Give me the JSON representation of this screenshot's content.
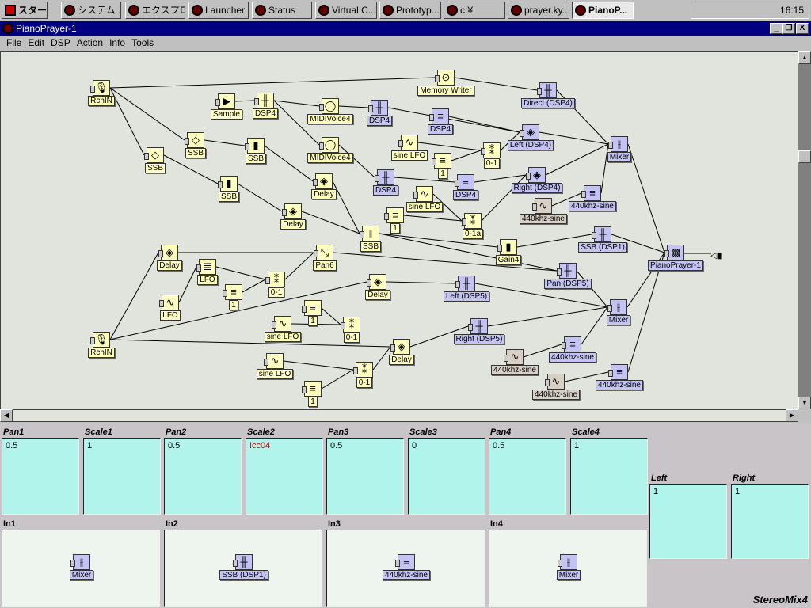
{
  "taskbar": {
    "start": "スタート",
    "buttons": [
      "システム ...",
      "エクスプロ...",
      "Launcher",
      "Status",
      "Virtual C...",
      "Prototyp...",
      "c:¥",
      "prayer.ky...",
      "PianoP..."
    ],
    "clock": "16:15"
  },
  "window": {
    "title": "PianoPrayer-1",
    "controls": [
      "_",
      "❐",
      "X"
    ]
  },
  "menu": [
    "File",
    "Edit",
    "DSP",
    "Action",
    "Info",
    "Tools"
  ],
  "graph": {
    "nodes": [
      {
        "label": "RchIN",
        "kind": "y",
        "icon": "mic-icon",
        "glyph": "🎙"
      },
      {
        "label": "Sample",
        "kind": "y",
        "icon": "sample-icon",
        "glyph": "▶"
      },
      {
        "label": "DSP4",
        "kind": "y",
        "icon": "dsp-icon",
        "glyph": "╫"
      },
      {
        "label": "MIDIVoice4",
        "kind": "y",
        "icon": "midi-icon",
        "glyph": "◯"
      },
      {
        "label": "MIDIVoice4",
        "kind": "y",
        "icon": "midi-icon",
        "glyph": "◯"
      },
      {
        "label": "SSB",
        "kind": "y",
        "icon": "ssb-ring-icon",
        "glyph": "◇"
      },
      {
        "label": "SSB",
        "kind": "y",
        "icon": "ssb-ring-icon",
        "glyph": "◇"
      },
      {
        "label": "SSB",
        "kind": "y",
        "icon": "fader-icon",
        "glyph": "▮"
      },
      {
        "label": "SSB",
        "kind": "y",
        "icon": "fader-icon",
        "glyph": "▮"
      },
      {
        "label": "Delay",
        "kind": "y",
        "icon": "delay-icon",
        "glyph": "◈"
      },
      {
        "label": "Delay",
        "kind": "y",
        "icon": "delay-icon",
        "glyph": "◈"
      },
      {
        "label": "SSB",
        "kind": "y",
        "icon": "mixer-icon",
        "glyph": "⫲"
      },
      {
        "label": "sine LFO",
        "kind": "y",
        "icon": "sine-icon",
        "glyph": "∿"
      },
      {
        "label": "1",
        "kind": "y",
        "icon": "constant-icon",
        "glyph": "≡"
      },
      {
        "label": "0-1",
        "kind": "y",
        "icon": "range-icon",
        "glyph": "⁑"
      },
      {
        "label": "sine LFO",
        "kind": "y",
        "icon": "sine-icon",
        "glyph": "∿"
      },
      {
        "label": "1",
        "kind": "y",
        "icon": "constant-icon",
        "glyph": "≡"
      },
      {
        "label": "0-1a",
        "kind": "y",
        "icon": "range-icon",
        "glyph": "⁑"
      },
      {
        "label": "Gain4",
        "kind": "y",
        "icon": "fader-icon",
        "glyph": "▮"
      },
      {
        "label": "Memory Writer",
        "kind": "y",
        "icon": "memory-icon",
        "glyph": "⊙"
      },
      {
        "label": "Delay",
        "kind": "y",
        "icon": "delay-icon",
        "glyph": "◈"
      },
      {
        "label": "LFO",
        "kind": "y",
        "icon": "lfo-icon",
        "glyph": "≣"
      },
      {
        "label": "LFO",
        "kind": "y",
        "icon": "sine-icon",
        "glyph": "∿"
      },
      {
        "label": "1",
        "kind": "y",
        "icon": "constant-icon",
        "glyph": "≡"
      },
      {
        "label": "0-1",
        "kind": "y",
        "icon": "range-icon",
        "glyph": "⁑"
      },
      {
        "label": "Pan6",
        "kind": "y",
        "icon": "pan-icon",
        "glyph": "⤡"
      },
      {
        "label": "Delay",
        "kind": "y",
        "icon": "delay-icon",
        "glyph": "◈"
      },
      {
        "label": "1",
        "kind": "y",
        "icon": "constant-icon",
        "glyph": "≡"
      },
      {
        "label": "sine LFO",
        "kind": "y",
        "icon": "sine-icon",
        "glyph": "∿"
      },
      {
        "label": "0-1",
        "kind": "y",
        "icon": "range-icon",
        "glyph": "⁑"
      },
      {
        "label": "RchIN",
        "kind": "y",
        "icon": "mic-icon",
        "glyph": "🎙"
      },
      {
        "label": "Delay",
        "kind": "y",
        "icon": "delay-icon",
        "glyph": "◈"
      },
      {
        "label": "sine LFO",
        "kind": "y",
        "icon": "sine-icon",
        "glyph": "∿"
      },
      {
        "label": "0-1",
        "kind": "y",
        "icon": "range-icon",
        "glyph": "⁑"
      },
      {
        "label": "1",
        "kind": "y",
        "icon": "constant-icon",
        "glyph": "≡"
      },
      {
        "label": "Direct (DSP4)",
        "kind": "b",
        "icon": "dsp-icon",
        "glyph": "╫"
      },
      {
        "label": "DSP4",
        "kind": "b",
        "icon": "dsp-icon",
        "glyph": "╫"
      },
      {
        "label": "DSP4",
        "kind": "b",
        "icon": "constant-icon",
        "glyph": "≡"
      },
      {
        "label": "Left (DSP4)",
        "kind": "b",
        "icon": "delay-icon",
        "glyph": "◈"
      },
      {
        "label": "Mixer",
        "kind": "b",
        "icon": "mixer-icon",
        "glyph": "⫲"
      },
      {
        "label": "DSP4",
        "kind": "b",
        "icon": "dsp-icon",
        "glyph": "╫"
      },
      {
        "label": "DSP4",
        "kind": "b",
        "icon": "constant-icon",
        "glyph": "≡"
      },
      {
        "label": "Right (DSP4)",
        "kind": "b",
        "icon": "delay-icon",
        "glyph": "◈"
      },
      {
        "label": "440khz-sine",
        "kind": "g",
        "icon": "sine-icon",
        "glyph": "∿"
      },
      {
        "label": "440khz-sine",
        "kind": "b",
        "icon": "constant-icon",
        "glyph": "≡"
      },
      {
        "label": "SSB (DSP1)",
        "kind": "b",
        "icon": "dsp-icon",
        "glyph": "╫"
      },
      {
        "label": "PianoPrayer-1",
        "kind": "b",
        "icon": "output-icon",
        "glyph": "▩"
      },
      {
        "label": "Pan (DSP5)",
        "kind": "b",
        "icon": "dsp-icon",
        "glyph": "╫"
      },
      {
        "label": "Left (DSP5)",
        "kind": "b",
        "icon": "dsp-icon",
        "glyph": "╫"
      },
      {
        "label": "Mixer",
        "kind": "b",
        "icon": "mixer-icon",
        "glyph": "⫲"
      },
      {
        "label": "Right (DSP5)",
        "kind": "b",
        "icon": "dsp-icon",
        "glyph": "╫"
      },
      {
        "label": "440khz-sine",
        "kind": "g",
        "icon": "sine-icon",
        "glyph": "∿"
      },
      {
        "label": "440khz-sine",
        "kind": "b",
        "icon": "constant-icon",
        "glyph": "≡"
      },
      {
        "label": "440khz-sine",
        "kind": "g",
        "icon": "sine-icon",
        "glyph": "∿"
      },
      {
        "label": "440khz-sine",
        "kind": "b",
        "icon": "constant-icon",
        "glyph": "≡"
      }
    ],
    "edges": [
      [
        0,
        19
      ],
      [
        19,
        35
      ],
      [
        0,
        5
      ],
      [
        0,
        6
      ],
      [
        1,
        2
      ],
      [
        2,
        3
      ],
      [
        2,
        4
      ],
      [
        3,
        36
      ],
      [
        36,
        38
      ],
      [
        37,
        38
      ],
      [
        5,
        7
      ],
      [
        6,
        8
      ],
      [
        7,
        9
      ],
      [
        8,
        10
      ],
      [
        4,
        40
      ],
      [
        9,
        11
      ],
      [
        10,
        11
      ],
      [
        11,
        18
      ],
      [
        40,
        41
      ],
      [
        12,
        14
      ],
      [
        13,
        14
      ],
      [
        14,
        38
      ],
      [
        41,
        42
      ],
      [
        15,
        17
      ],
      [
        16,
        17
      ],
      [
        17,
        42
      ],
      [
        38,
        39
      ],
      [
        42,
        39
      ],
      [
        35,
        39
      ],
      [
        44,
        39
      ],
      [
        43,
        44
      ],
      [
        39,
        46
      ],
      [
        18,
        45
      ],
      [
        45,
        46
      ],
      [
        30,
        20
      ],
      [
        30,
        26
      ],
      [
        30,
        31
      ],
      [
        20,
        25
      ],
      [
        22,
        21
      ],
      [
        21,
        24
      ],
      [
        23,
        24
      ],
      [
        24,
        25
      ],
      [
        25,
        47
      ],
      [
        26,
        48
      ],
      [
        48,
        49
      ],
      [
        28,
        29
      ],
      [
        27,
        29
      ],
      [
        32,
        33
      ],
      [
        34,
        33
      ],
      [
        33,
        31
      ],
      [
        31,
        50
      ],
      [
        50,
        49
      ],
      [
        47,
        49
      ],
      [
        51,
        52
      ],
      [
        52,
        49
      ],
      [
        53,
        54
      ],
      [
        54,
        46
      ],
      [
        49,
        46
      ],
      [
        11,
        47
      ]
    ]
  },
  "params": [
    {
      "label": "Pan1",
      "value": "0.5"
    },
    {
      "label": "Scale1",
      "value": "1"
    },
    {
      "label": "Pan2",
      "value": "0.5"
    },
    {
      "label": "Scale2",
      "value": "!cc04",
      "error": true
    },
    {
      "label": "Pan3",
      "value": "0.5"
    },
    {
      "label": "Scale3",
      "value": "0"
    },
    {
      "label": "Pan4",
      "value": "0.5"
    },
    {
      "label": "Scale4",
      "value": "1"
    }
  ],
  "outputs": [
    {
      "label": "Left",
      "value": "1"
    },
    {
      "label": "Right",
      "value": "1"
    }
  ],
  "inputs": [
    {
      "label": "In1",
      "node": "Mixer",
      "glyph": "⫲"
    },
    {
      "label": "In2",
      "node": "SSB (DSP1)",
      "glyph": "╫"
    },
    {
      "label": "In3",
      "node": "440khz-sine",
      "glyph": "≡"
    },
    {
      "label": "In4",
      "node": "Mixer",
      "glyph": "⫲"
    }
  ],
  "panel_title": "StereoMix4"
}
